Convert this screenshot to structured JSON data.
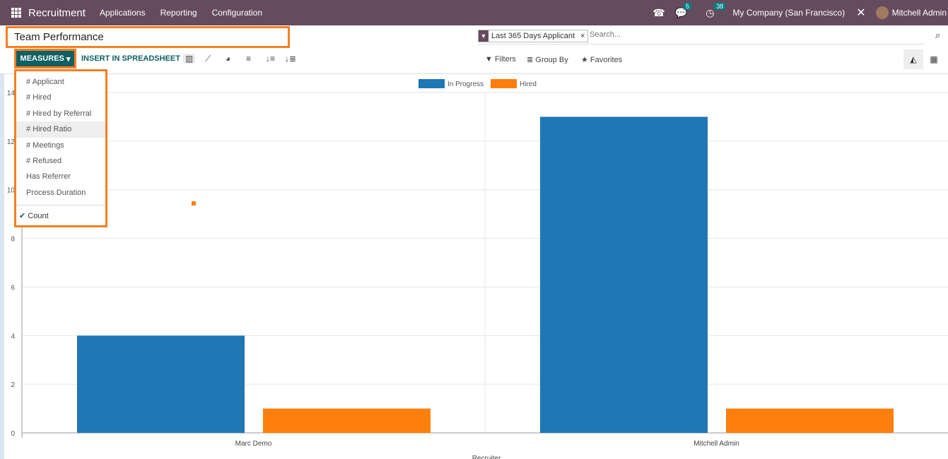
{
  "navbar": {
    "app": "Recruitment",
    "menus": [
      "Applications",
      "Reporting",
      "Configuration"
    ],
    "messages_count": "5",
    "activities_count": "38",
    "company": "My Company (San Francisco)",
    "user": "Mitchell Admin"
  },
  "view": {
    "title": "Team Performance"
  },
  "search": {
    "facet": "Last 365 Days Applicant",
    "placeholder": "Search..."
  },
  "toolbar": {
    "measures": "MEASURES",
    "insert": "INSERT IN SPREADSHEET",
    "filters": "Filters",
    "group_by": "Group By",
    "favorites": "Favorites"
  },
  "measures_menu": {
    "items": [
      "# Applicant",
      "# Hired",
      "# Hired by Referral",
      "# Hired Ratio",
      "# Meetings",
      "# Refused",
      "Has Referrer",
      "Process Duration"
    ],
    "highlighted": "# Hired Ratio",
    "count": "Count",
    "count_checked": true
  },
  "chart_data": {
    "type": "bar",
    "categories": [
      "Marc Demo",
      "Mitchell Admin"
    ],
    "xlabel": "Recruiter",
    "ylabel": "",
    "ylim": [
      0,
      14
    ],
    "yticks": [
      0,
      2,
      4,
      6,
      8,
      10,
      12,
      14
    ],
    "legend": "top-center",
    "grid": true,
    "series": [
      {
        "name": "In Progress",
        "color": "#1f77b4",
        "values": [
          4,
          13
        ]
      },
      {
        "name": "Hired",
        "color": "#ff7f0e",
        "values": [
          1,
          1
        ]
      }
    ]
  }
}
